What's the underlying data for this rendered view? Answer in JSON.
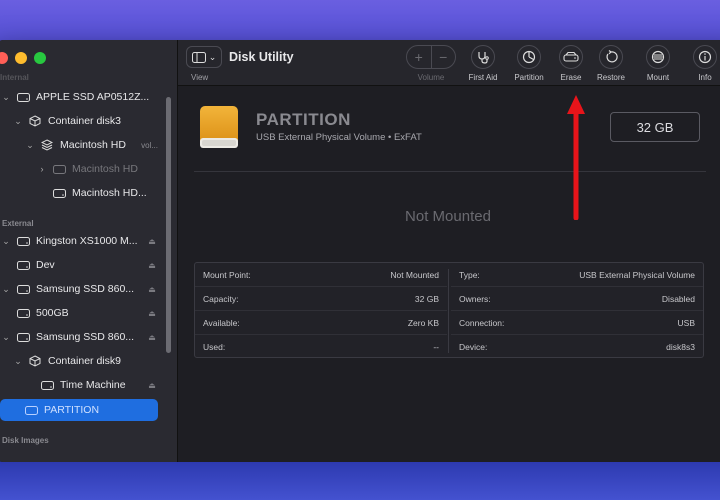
{
  "app": {
    "title": "Disk Utility"
  },
  "toolbar": {
    "view_label": "View",
    "volume_label": "Volume",
    "plus": "+",
    "minus": "−",
    "items": [
      {
        "label": "First Aid",
        "icon": "stethoscope-icon"
      },
      {
        "label": "Partition",
        "icon": "pie-chart-icon"
      },
      {
        "label": "Erase",
        "icon": "erase-drive-icon"
      },
      {
        "label": "Restore",
        "icon": "restore-icon"
      },
      {
        "label": "Mount",
        "icon": "mount-icon"
      },
      {
        "label": "Info",
        "icon": "info-icon"
      }
    ]
  },
  "sidebar": {
    "internal_header": "Internal",
    "external_header": "External",
    "disk_images_header": "Disk Images",
    "items": [
      {
        "label": "APPLE SSD AP0512Z...",
        "icon": "drive-icon"
      },
      {
        "label": "Container disk3",
        "icon": "container-icon"
      },
      {
        "label": "Macintosh HD",
        "extra": "vol...",
        "icon": "volume-stack-icon"
      },
      {
        "label": "Macintosh HD",
        "icon": "drive-icon"
      },
      {
        "label": "Macintosh HD...",
        "icon": "drive-icon"
      },
      {
        "label": "Kingston XS1000 M...",
        "icon": "drive-icon"
      },
      {
        "label": "Dev",
        "icon": "drive-icon"
      },
      {
        "label": "Samsung SSD 860...",
        "icon": "drive-icon"
      },
      {
        "label": "500GB",
        "icon": "drive-icon"
      },
      {
        "label": "Samsung SSD 860...",
        "icon": "drive-icon"
      },
      {
        "label": "Container disk9",
        "icon": "container-icon"
      },
      {
        "label": "Time Machine",
        "icon": "drive-icon"
      },
      {
        "label": "PARTITION",
        "icon": "drive-icon"
      }
    ]
  },
  "volume": {
    "name": "PARTITION",
    "subtitle": "USB External Physical Volume • ExFAT",
    "capacity": "32 GB",
    "status": "Not Mounted"
  },
  "info": {
    "left": [
      {
        "key": "Mount Point:",
        "value": "Not Mounted"
      },
      {
        "key": "Capacity:",
        "value": "32 GB"
      },
      {
        "key": "Available:",
        "value": "Zero KB"
      },
      {
        "key": "Used:",
        "value": "--"
      }
    ],
    "right": [
      {
        "key": "Type:",
        "value": "USB External Physical Volume"
      },
      {
        "key": "Owners:",
        "value": "Disabled"
      },
      {
        "key": "Connection:",
        "value": "USB"
      },
      {
        "key": "Device:",
        "value": "disk8s3"
      }
    ]
  },
  "colors": {
    "accent": "#1f6ee0",
    "annotation_arrow": "#e8141a",
    "drive": "#e9a21f"
  }
}
